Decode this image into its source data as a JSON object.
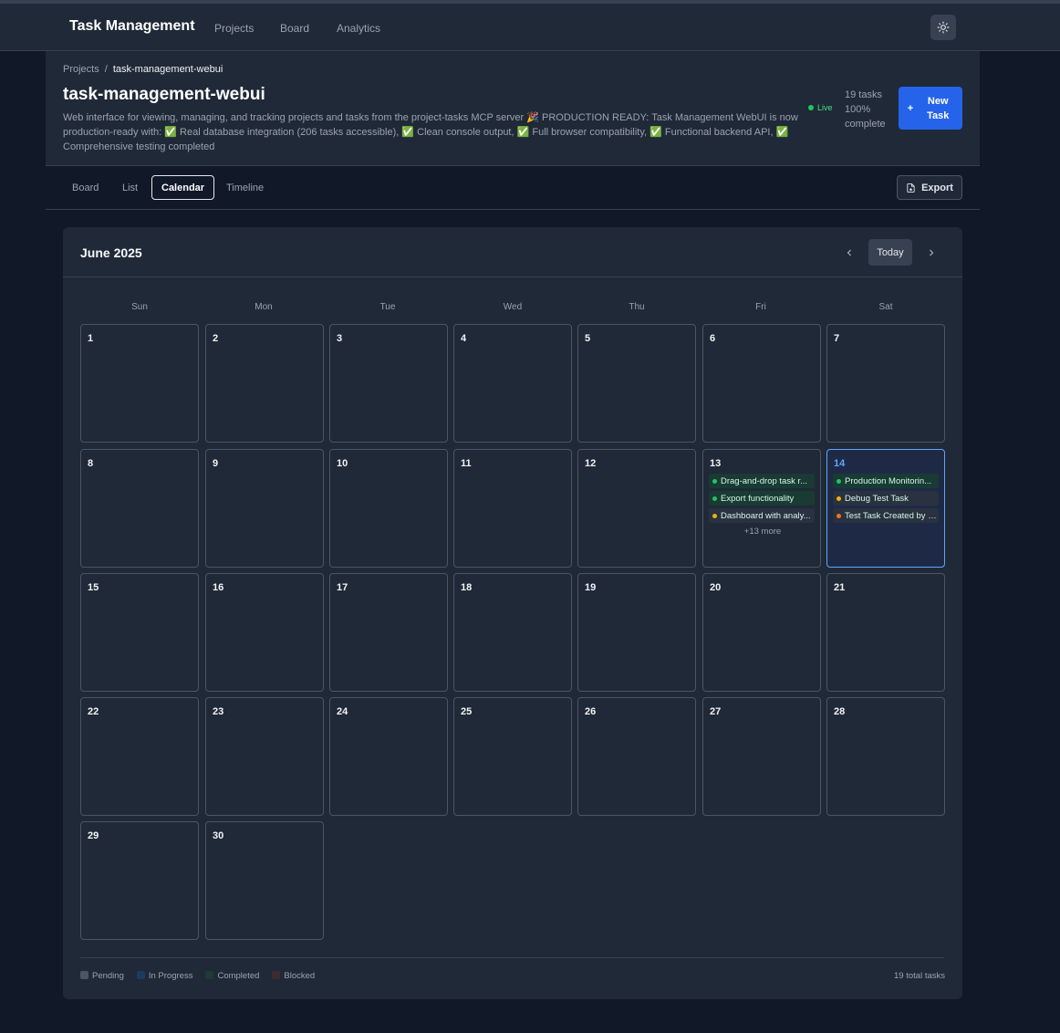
{
  "app": {
    "title": "Task Management",
    "nav": [
      "Projects",
      "Board",
      "Analytics"
    ]
  },
  "breadcrumb": {
    "root": "Projects",
    "current": "task-management-webui"
  },
  "project": {
    "title": "task-management-webui",
    "description": "Web interface for viewing, managing, and tracking projects and tasks from the project-tasks MCP server 🎉 PRODUCTION READY: Task Management WebUI is now production-ready with: ✅ Real database integration (206 tasks accessible), ✅ Clean console output, ✅ Full browser compatibility, ✅ Functional backend API, ✅ Comprehensive testing completed",
    "live": "Live",
    "tasks": "19 tasks",
    "percent": "100%",
    "complete": "complete",
    "new_task": "New Task"
  },
  "tabs": {
    "board": "Board",
    "list": "List",
    "calendar": "Calendar",
    "timeline": "Timeline",
    "export": "Export"
  },
  "calendar": {
    "month": "June 2025",
    "today": "Today",
    "weekdays": [
      "Sun",
      "Mon",
      "Tue",
      "Wed",
      "Thu",
      "Fri",
      "Sat"
    ],
    "days": [
      "1",
      "2",
      "3",
      "4",
      "5",
      "6",
      "7",
      "8",
      "9",
      "10",
      "11",
      "12",
      "13",
      "14",
      "15",
      "16",
      "17",
      "18",
      "19",
      "20",
      "21",
      "22",
      "23",
      "24",
      "25",
      "26",
      "27",
      "28",
      "29",
      "30"
    ],
    "day13": {
      "events": [
        {
          "title": "Drag-and-drop task r...",
          "color": "#22c55e"
        },
        {
          "title": "Export functionality",
          "color": "#22c55e"
        },
        {
          "title": "Dashboard with analy...",
          "color": "#eab308"
        }
      ],
      "more": "+13 more"
    },
    "day14": {
      "events": [
        {
          "title": "Production Monitorin...",
          "color": "#22c55e"
        },
        {
          "title": "Debug Test Task",
          "color": "#eab308"
        },
        {
          "title": "Test Task Created by P...",
          "color": "#f97316"
        }
      ]
    },
    "legend": [
      {
        "label": "Pending",
        "color": "#4b5563"
      },
      {
        "label": "In Progress",
        "color": "#1e3a5f"
      },
      {
        "label": "Completed",
        "color": "#1f3b35"
      },
      {
        "label": "Blocked",
        "color": "#3f2a30"
      }
    ],
    "total": "19 total tasks"
  }
}
